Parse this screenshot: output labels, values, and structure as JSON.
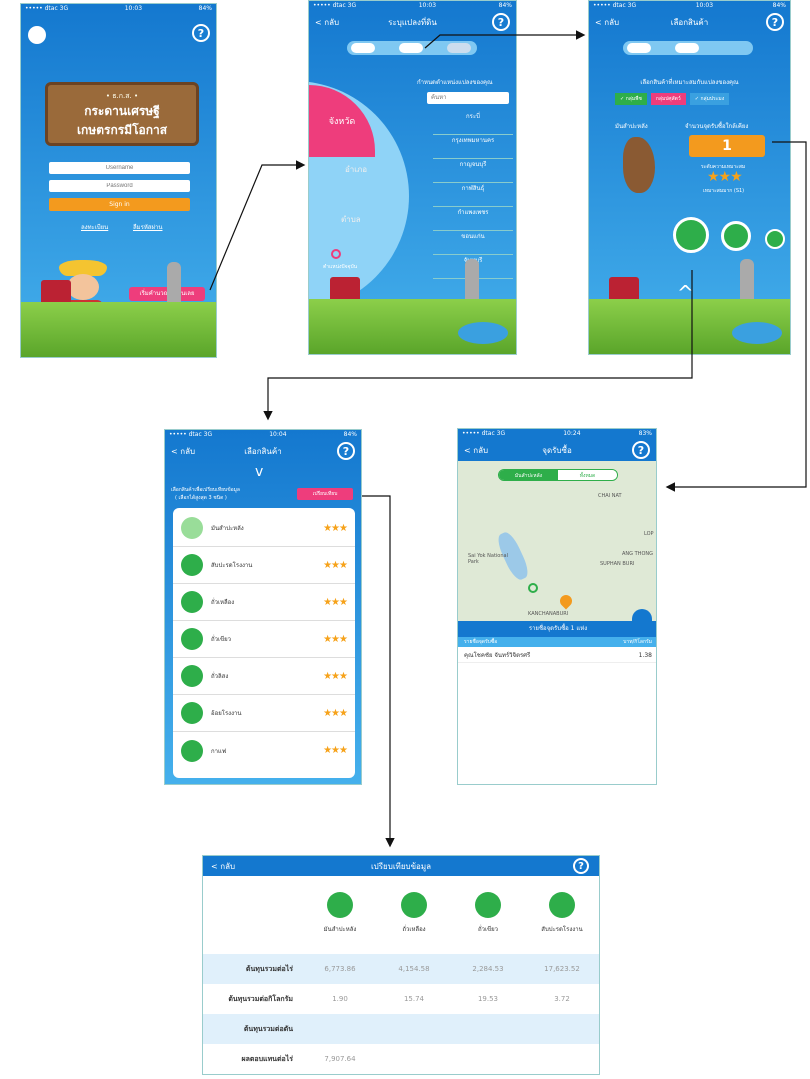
{
  "status": {
    "s1": {
      "carrier": "••••• dtac 3G",
      "time": "10:03",
      "battery": "84%"
    },
    "s2": {
      "carrier": "••••• dtac 3G",
      "time": "10:03",
      "battery": "84%"
    },
    "s3": {
      "carrier": "••••• dtac 3G",
      "time": "10:03",
      "battery": "84%"
    },
    "s4": {
      "carrier": "••••• dtac 3G",
      "time": "10:04",
      "battery": "84%"
    },
    "s5": {
      "carrier": "••••• dtac 3G",
      "time": "10:24",
      "battery": "83%"
    }
  },
  "login": {
    "sign_small": "• ธ.ก.ส. •",
    "sign_line1": "กระดานเศรษฐี",
    "sign_line2": "เกษตรกรมีโอกาส",
    "user_placeholder": "Username",
    "pass_placeholder": "Password",
    "login_label": "Sign in",
    "forgot_label": "ลงทะเบียน",
    "register_label": "ลืมรหัสผ่าน",
    "start_label": "เริ่มคำนวณต้นทุนเลย"
  },
  "location": {
    "back": "< กลับ",
    "title": "ระบุแปลงที่ดิน",
    "hint": "กำหนดตำแหน่งแปลงของคุณ",
    "search_placeholder": "ค้นหา",
    "wheel": [
      "จังหวัด",
      "อำเภอ",
      "ตำบล"
    ],
    "current_location": "ตำแหน่งปัจจุบัน",
    "provinces": [
      "กระบี่",
      "กรุงเทพมหานคร",
      "กาญจนบุรี",
      "กาฬสินธุ์",
      "กำแพงเพชร",
      "ขอนแก่น",
      "จันทบุรี"
    ]
  },
  "choose": {
    "back": "< กลับ",
    "title": "เลือกสินค้า",
    "hint": "เลือกสินค้าที่เหมาะสมกับแปลงของคุณ",
    "filters": [
      "✓ กลุ่มพืช",
      "กลุ่มปศุสัตว์",
      "✓ กลุ่มประมง"
    ],
    "product": "มันสำปะหลัง",
    "buyers_label": "จำนวนจุดรับซื้อใกล้เคียง",
    "buyers_count": "1",
    "suit_label": "ระดับความเหมาะสม",
    "suit_value": "เหมาะสมมาก (S1)"
  },
  "list": {
    "back": "< กลับ",
    "title": "เลือกสินค้า",
    "hint": "เลือกสินค้าเพื่อเปรียบเทียบข้อมูล",
    "hint2": "( เลือกได้สูงสุด 3 ชนิด )",
    "compare_btn": "เปรียบเทียบ",
    "items": [
      "มันสำปะหลัง",
      "สับปะรดโรงงาน",
      "ถั่วเหลือง",
      "ถั่วเขียว",
      "ถั่วลิสง",
      "อ้อยโรงงาน",
      "กาแฟ"
    ],
    "stars": "★★★"
  },
  "map": {
    "back": "< กลับ",
    "title": "จุดรับซื้อ",
    "tab_active": "มันสำปะหลัง",
    "tab_other": "ทั้งหมด",
    "labels": [
      "CHAI NAT",
      "SUPHAN BURI",
      "KANCHANABURI",
      "ANG THONG",
      "Sai Yok National Park",
      "LOP"
    ],
    "summary": "รายชื่อจุดรับซื้อ 1 แห่ง",
    "col_name": "รายชื่อจุดรับซื้อ",
    "col_price": "บาท/กิโลกรัม",
    "row_name": "คุณโชคชัย จันทร์วิจิตรศรี",
    "row_price": "1.38"
  },
  "compare": {
    "back": "< กลับ",
    "title": "เปรียบเทียบข้อมูล",
    "crops": [
      "มันสำปะหลัง",
      "ถั่วเหลือง",
      "ถั่วเขียว",
      "สับปะรดโรงงาน"
    ],
    "rows": [
      {
        "label": "ต้นทุนรวมต่อไร่",
        "values": [
          "6,773.86",
          "4,154.58",
          "2,284.53",
          "17,623.52"
        ]
      },
      {
        "label": "ต้นทุนรวมต่อกิโลกรัม",
        "values": [
          "1.90",
          "15.74",
          "19.53",
          "3.72"
        ]
      },
      {
        "label": "ต้นทุนรวมต่อตัน",
        "values": [
          "",
          "",
          "",
          ""
        ]
      },
      {
        "label": "ผลตอบแทนต่อไร่",
        "values": [
          "7,907.64",
          "",
          "",
          ""
        ]
      }
    ]
  },
  "colors": {
    "blue": "#1478cf",
    "orange": "#f39a1e",
    "pink": "#ee3d7c",
    "green": "#2eae4a",
    "star": "#f6a21a"
  }
}
